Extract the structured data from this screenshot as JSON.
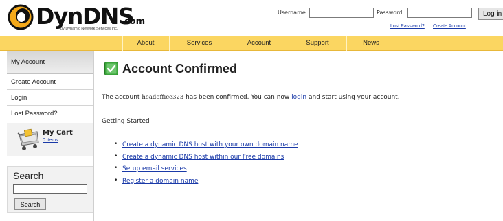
{
  "header": {
    "logo_text": "DynDNS",
    "logo_suffix": ".com",
    "logo_tagline": "by Dynamic Network Services Inc.",
    "username_label": "Username",
    "username_value": "",
    "password_label": "Password",
    "password_value": "",
    "login_button": "Log in",
    "lost_password_link": "Lost Password?",
    "create_account_link": "Create Account"
  },
  "nav": {
    "items": [
      "About",
      "Services",
      "Account",
      "Support",
      "News"
    ]
  },
  "sidebar": {
    "heading": "My Account",
    "items": [
      "Create Account",
      "Login",
      "Lost Password?"
    ],
    "cart": {
      "title": "My Cart",
      "items_link": "0 items"
    },
    "search": {
      "title": "Search",
      "input_value": "",
      "button": "Search"
    }
  },
  "main": {
    "title": "Account Confirmed",
    "confirm_prefix": "The account ",
    "account_name": "headoffice323",
    "confirm_middle": " has been confirmed. You can now ",
    "login_link": "login",
    "confirm_suffix": " and start using your account.",
    "getting_started": "Getting Started",
    "links": [
      "Create a dynamic DNS host with your own domain name",
      "Create a dynamic DNS host within our Free domains",
      "Setup email services",
      "Register a domain name"
    ]
  },
  "colors": {
    "nav_background": "#fbd661",
    "link": "#1a3aa8",
    "check_icon": "#3aa43a"
  }
}
